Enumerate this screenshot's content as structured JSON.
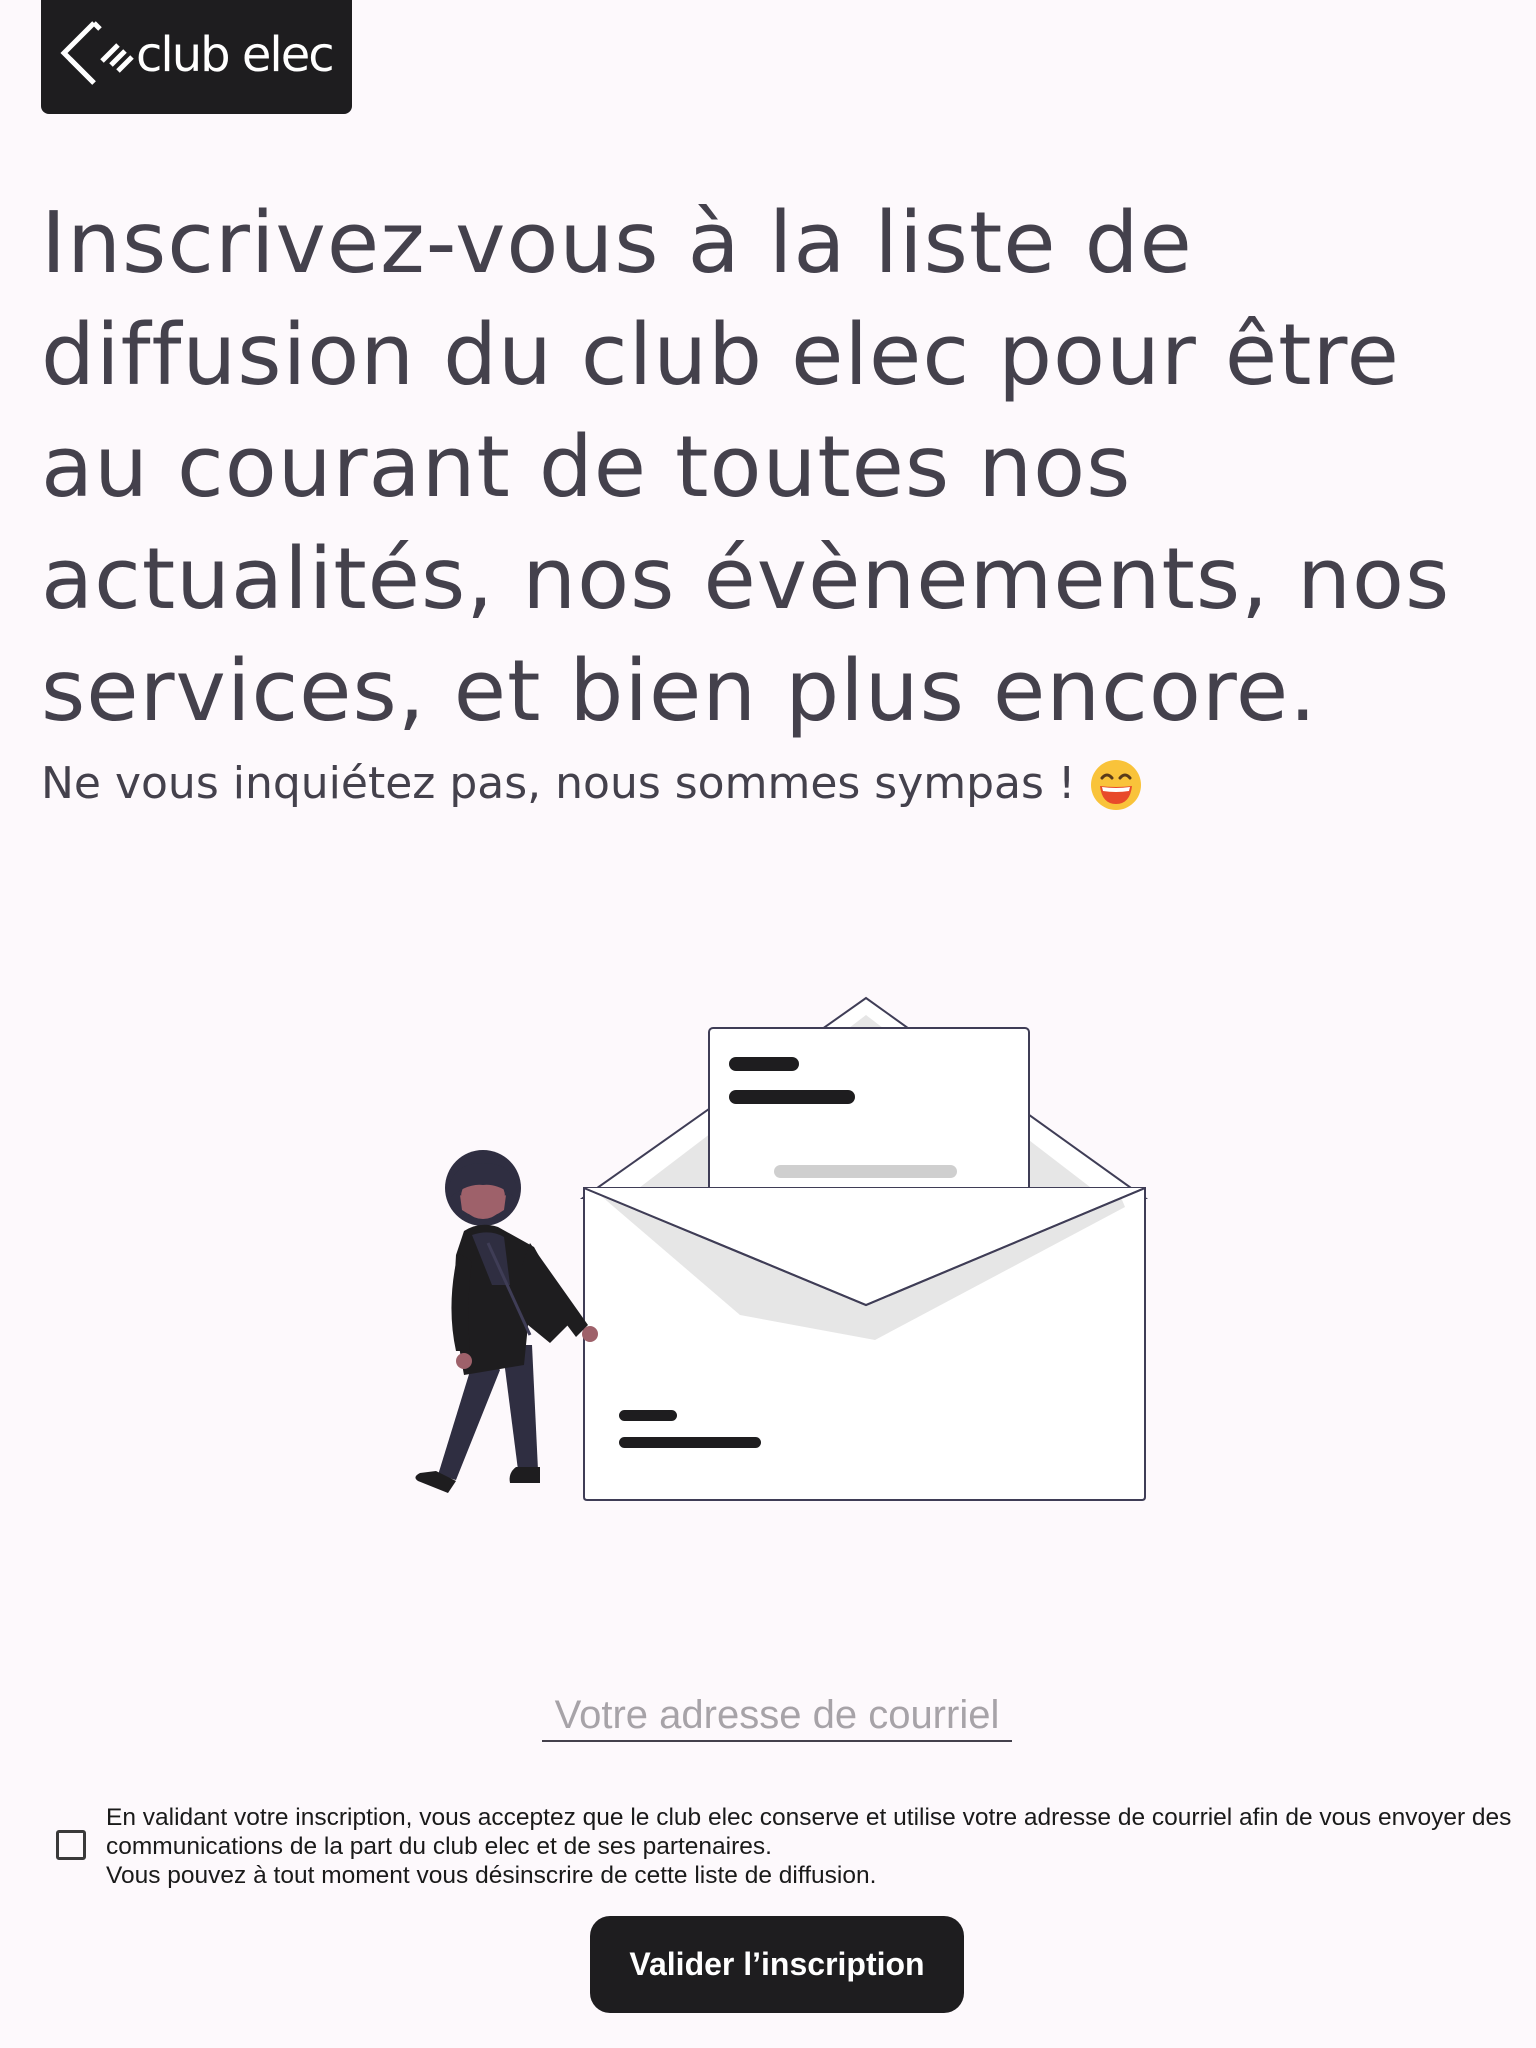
{
  "header": {
    "logo_text": "club elec"
  },
  "main": {
    "headline": "Inscrivez-vous à la liste de diffusion du club elec pour être au courant de toutes nos actualités, nos évènements, nos services, et bien plus encore.",
    "subtitle": "Ne vous inquiétez pas, nous sommes sympas !",
    "emoji_icon": "smiling-face-icon"
  },
  "form": {
    "email_placeholder": "Votre adresse de courriel",
    "email_value": "",
    "consent_checked": false,
    "consent_line1": "En validant votre inscription, vous acceptez que le club elec conserve et utilise votre adresse de courriel afin de vous envoyer des communications de la part du club elec et de ses partenaires.",
    "consent_line2": "Vous pouvez à tout moment vous désinscrire de cette liste de diffusion.",
    "submit_label": "Valider l’inscription"
  },
  "colors": {
    "background": "#fdf9fc",
    "text": "#44414c",
    "dark": "#1e1d1f",
    "emoji": "#f9c33a"
  }
}
